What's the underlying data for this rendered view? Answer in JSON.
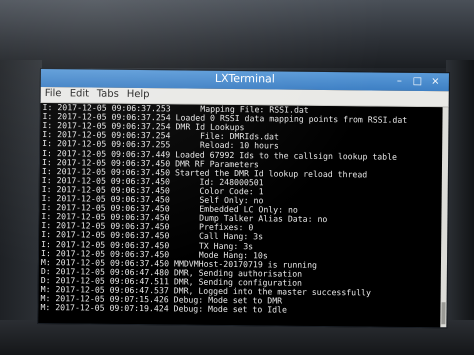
{
  "window": {
    "title": "LXTerminal",
    "buttons": {
      "minimize": "–",
      "maximize": "□",
      "close": "×"
    }
  },
  "menubar": {
    "items": [
      "File",
      "Edit",
      "Tabs",
      "Help"
    ]
  },
  "terminal": {
    "lines": [
      "I: 2017-12-05 09:06:37.253      Mapping File: RSSI.dat",
      "I: 2017-12-05 09:06:37.254 Loaded 0 RSSI data mapping points from RSSI.dat",
      "I: 2017-12-05 09:06:37.254 DMR Id Lookups",
      "I: 2017-12-05 09:06:37.254      File: DMRIds.dat",
      "I: 2017-12-05 09:06:37.255      Reload: 10 hours",
      "I: 2017-12-05 09:06:37.449 Loaded 67992 Ids to the callsign lookup table",
      "I: 2017-12-05 09:06:37.450 DMR RF Parameters",
      "I: 2017-12-05 09:06:37.450 Started the DMR Id lookup reload thread",
      "I: 2017-12-05 09:06:37.450      Id: 248000501",
      "I: 2017-12-05 09:06:37.450      Color Code: 1",
      "I: 2017-12-05 09:06:37.450      Self Only: no",
      "I: 2017-12-05 09:06:37.450      Embedded LC Only: no",
      "I: 2017-12-05 09:06:37.450      Dump Talker Alias Data: no",
      "I: 2017-12-05 09:06:37.450      Prefixes: 0",
      "I: 2017-12-05 09:06:37.450      Call Hang: 3s",
      "I: 2017-12-05 09:06:37.450      TX Hang: 3s",
      "I: 2017-12-05 09:06:37.450      Mode Hang: 10s",
      "M: 2017-12-05 09:06:37.450 MMDVMHost-20170719 is running",
      "D: 2017-12-05 09:06:47.480 DMR, Sending authorisation",
      "D: 2017-12-05 09:06:47.511 DMR, Sending configuration",
      "M: 2017-12-05 09:06:47.537 DMR, Logged into the master successfully",
      "M: 2017-12-05 09:07:15.426 Debug: Mode set to DMR",
      "M: 2017-12-05 09:07:19.424 Debug: Mode set to Idle"
    ]
  }
}
